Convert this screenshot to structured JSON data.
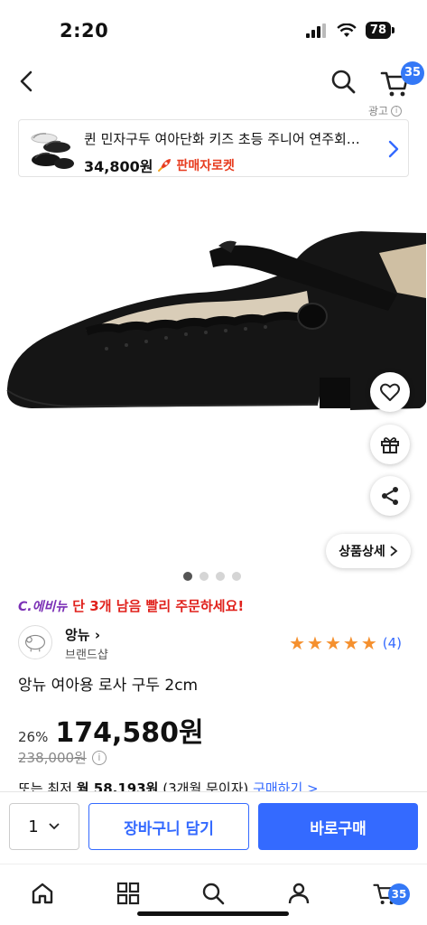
{
  "status": {
    "time": "2:20",
    "battery": "78"
  },
  "nav": {
    "cart_badge": "35"
  },
  "ad": {
    "label": "광고",
    "title": "퀸 민자구두 여아단화 키즈 초등 주니어 연주회…",
    "price": "34,800원",
    "rocket_label": "판매자로켓"
  },
  "product": {
    "detail_button": "상품상세",
    "image_dots": 4,
    "active_dot": 0,
    "urgency_brand": "C.에비뉴",
    "urgency_text": "단 3개 남음 빨리 주문하세요!",
    "brand_name": "앙뉴",
    "brand_sub": "브랜드샵",
    "rating": 5,
    "review_count": "(4)",
    "title": "앙뉴 여아용 로사 구두 2cm",
    "discount": "26%",
    "sale_price": "174,580원",
    "original_price": "238,000원",
    "installment_prefix": "또는 최저",
    "installment_amount": "월 58,193원",
    "installment_detail": "(3개월 무이자)",
    "installment_link": "구매하기 >"
  },
  "purchase": {
    "quantity": "1",
    "add_to_cart": "장바구니 담기",
    "buy_now": "바로구매"
  },
  "tabbar": {
    "cart_badge": "35"
  },
  "colors": {
    "accent": "#346aff",
    "badge": "#3478f6",
    "star": "#f5902e",
    "urgency": "#e0201b"
  },
  "icons": [
    "back-icon",
    "search-icon",
    "cart-icon",
    "heart-icon",
    "gift-icon",
    "share-icon",
    "home-icon",
    "category-icon",
    "search-tab-icon",
    "user-icon",
    "cart-tab-icon"
  ]
}
